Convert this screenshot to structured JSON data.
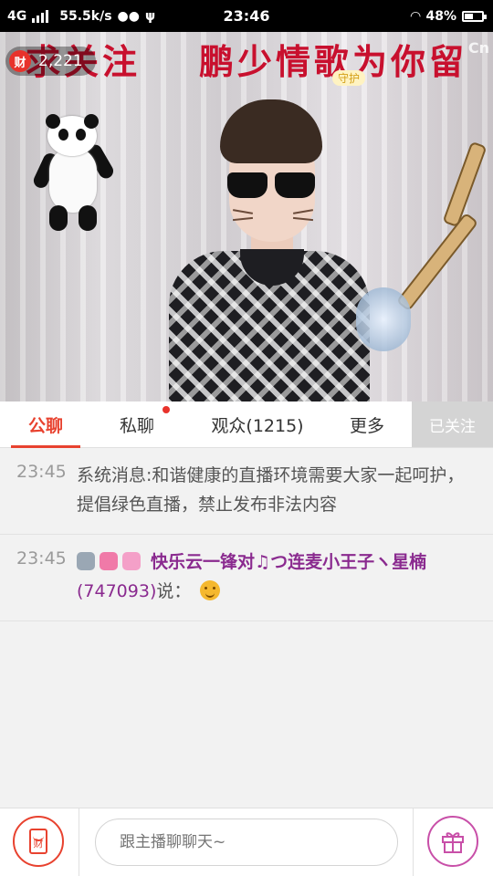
{
  "status_bar": {
    "network": "4G",
    "speed": "55.5k/s",
    "time": "23:46",
    "battery": "48%",
    "battery_level": 0.48
  },
  "stream": {
    "banner_left": "求关注",
    "banner_right": "鹏少情歌为你留",
    "viewer_badge_label": "财",
    "viewer_count": "2,221",
    "watermark": "Cn"
  },
  "tabs": [
    {
      "label": "公聊",
      "active": true
    },
    {
      "label": "私聊",
      "has_dot": true
    },
    {
      "label": "观众(1215)"
    },
    {
      "label": "更多"
    }
  ],
  "follow_button": "已关注",
  "messages": [
    {
      "time": "23:45",
      "text": "系统消息:和谐健康的直播环境需要大家一起呵护，提倡绿色直播，禁止发布非法内容"
    },
    {
      "time": "23:45",
      "username": "快乐云一锋对♫つ连麦小王子ヽ星楠",
      "user_id": "(747093)",
      "suffix": "说："
    }
  ],
  "bottom": {
    "red_packet_label": "财",
    "chat_placeholder": "跟主播聊聊天~"
  },
  "colors": {
    "accent": "#e8422f",
    "username": "#8a2a8f"
  }
}
